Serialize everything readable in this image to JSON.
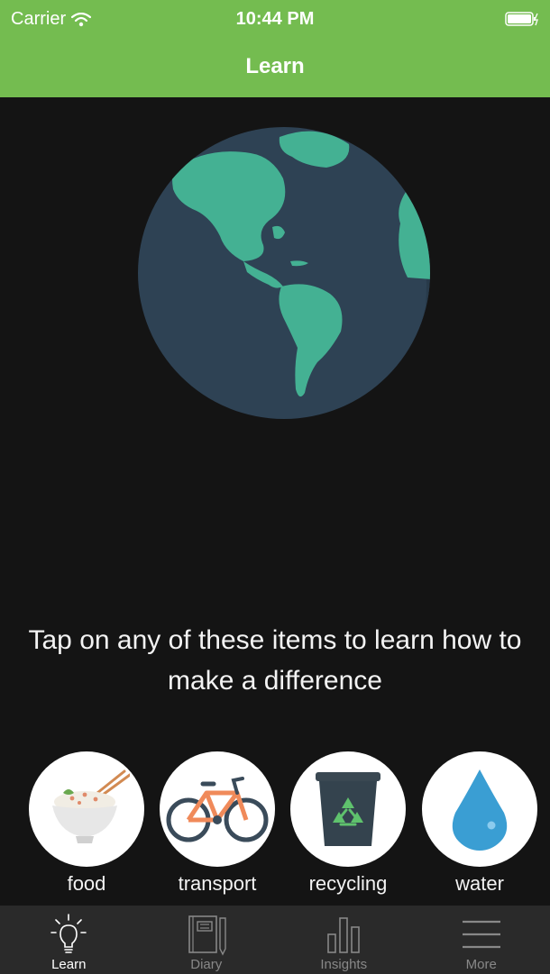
{
  "status_bar": {
    "carrier": "Carrier",
    "time": "10:44 PM"
  },
  "nav": {
    "title": "Learn"
  },
  "main": {
    "prompt": "Tap on any of these items to learn how to make a difference"
  },
  "categories": [
    {
      "label": "food",
      "icon": "rice-bowl-icon"
    },
    {
      "label": "transport",
      "icon": "bicycle-icon"
    },
    {
      "label": "recycling",
      "icon": "recycling-bin-icon"
    },
    {
      "label": "water",
      "icon": "water-drop-icon"
    }
  ],
  "tabs": [
    {
      "label": "Learn",
      "icon": "lightbulb-icon",
      "active": true
    },
    {
      "label": "Diary",
      "icon": "notebook-icon",
      "active": false
    },
    {
      "label": "Insights",
      "icon": "bar-chart-icon",
      "active": false
    },
    {
      "label": "More",
      "icon": "menu-icon",
      "active": false
    }
  ],
  "colors": {
    "header": "#74bc50",
    "background": "#141414",
    "tabbar": "#2a2a2a",
    "globe_ocean": "#2e4254",
    "globe_land": "#44b193"
  }
}
